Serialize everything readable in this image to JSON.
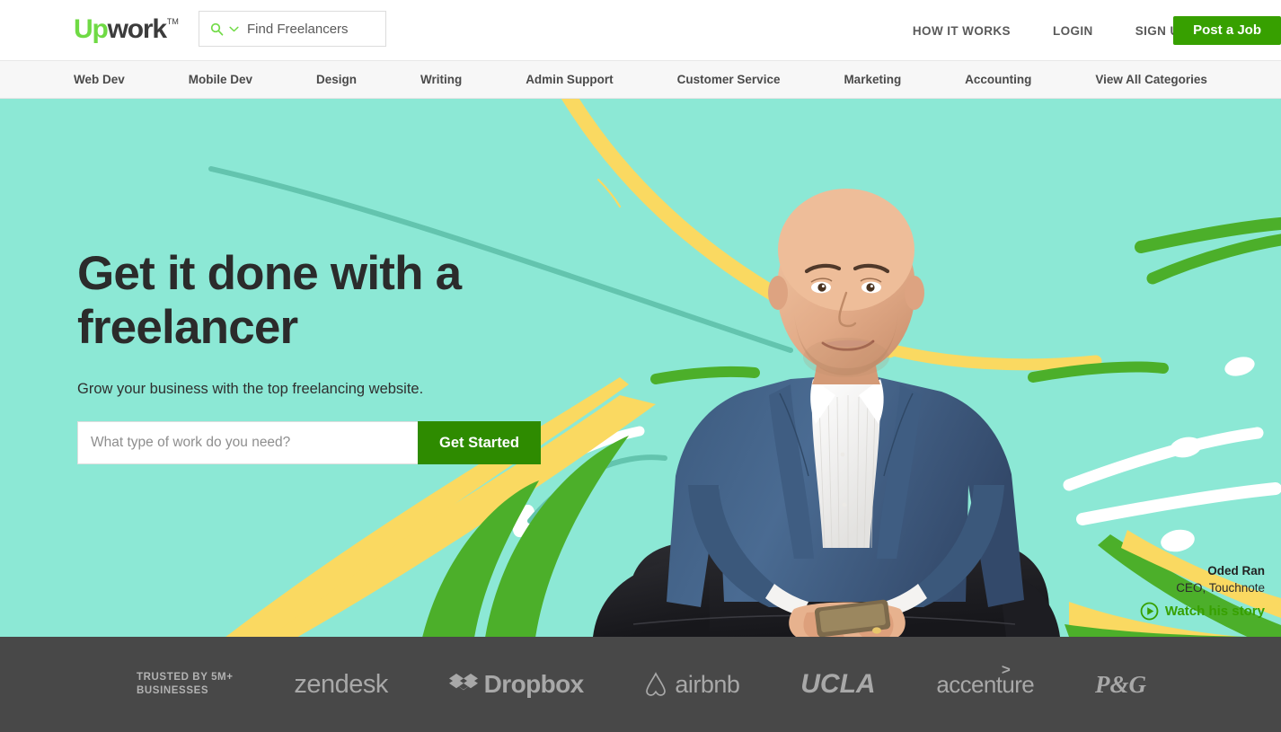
{
  "header": {
    "logo": {
      "part1": "Up",
      "part2": "work",
      "tm": "TM"
    },
    "find_box": {
      "label": "Find Freelancers",
      "search_icon": "search-icon",
      "chevron_icon": "chevron-down-icon"
    },
    "nav": [
      {
        "label": "HOW IT WORKS"
      },
      {
        "label": "LOGIN"
      },
      {
        "label": "SIGN UP"
      }
    ],
    "post_job_label": "Post a Job"
  },
  "categories": [
    {
      "label": "Web Dev"
    },
    {
      "label": "Mobile Dev"
    },
    {
      "label": "Design"
    },
    {
      "label": "Writing"
    },
    {
      "label": "Admin Support"
    },
    {
      "label": "Customer Service"
    },
    {
      "label": "Marketing"
    },
    {
      "label": "Accounting"
    },
    {
      "label": "View All Categories"
    }
  ],
  "hero": {
    "title_line1": "Get it done with a",
    "title_line2": "freelancer",
    "subtitle": "Grow your business with the top freelancing website.",
    "search_placeholder": "What type of work do you need?",
    "search_value": "",
    "cta_label": "Get Started",
    "background_color": "#8CE8D5"
  },
  "attribution": {
    "name": "Oded Ran",
    "role": "CEO, Touchnote",
    "watch_label": "Watch his story",
    "play_icon": "play-circle-icon",
    "link_color": "#37A000"
  },
  "trusted": {
    "label": "TRUSTED BY 5M+\nBUSINESSES",
    "logos": [
      {
        "name": "zendesk",
        "text": "zendesk"
      },
      {
        "name": "dropbox",
        "text": "Dropbox"
      },
      {
        "name": "airbnb",
        "text": "airbnb"
      },
      {
        "name": "ucla",
        "text": "UCLA"
      },
      {
        "name": "accenture",
        "text": "accenture",
        "arrow": ">"
      },
      {
        "name": "pg",
        "text": "P&G"
      }
    ],
    "background_color": "#484848"
  },
  "colors": {
    "brand_green": "#6FDA44",
    "button_green": "#37A000",
    "cta_green": "#2E8B00",
    "hero_teal": "#8CE8D5",
    "footer_gray": "#484848"
  }
}
